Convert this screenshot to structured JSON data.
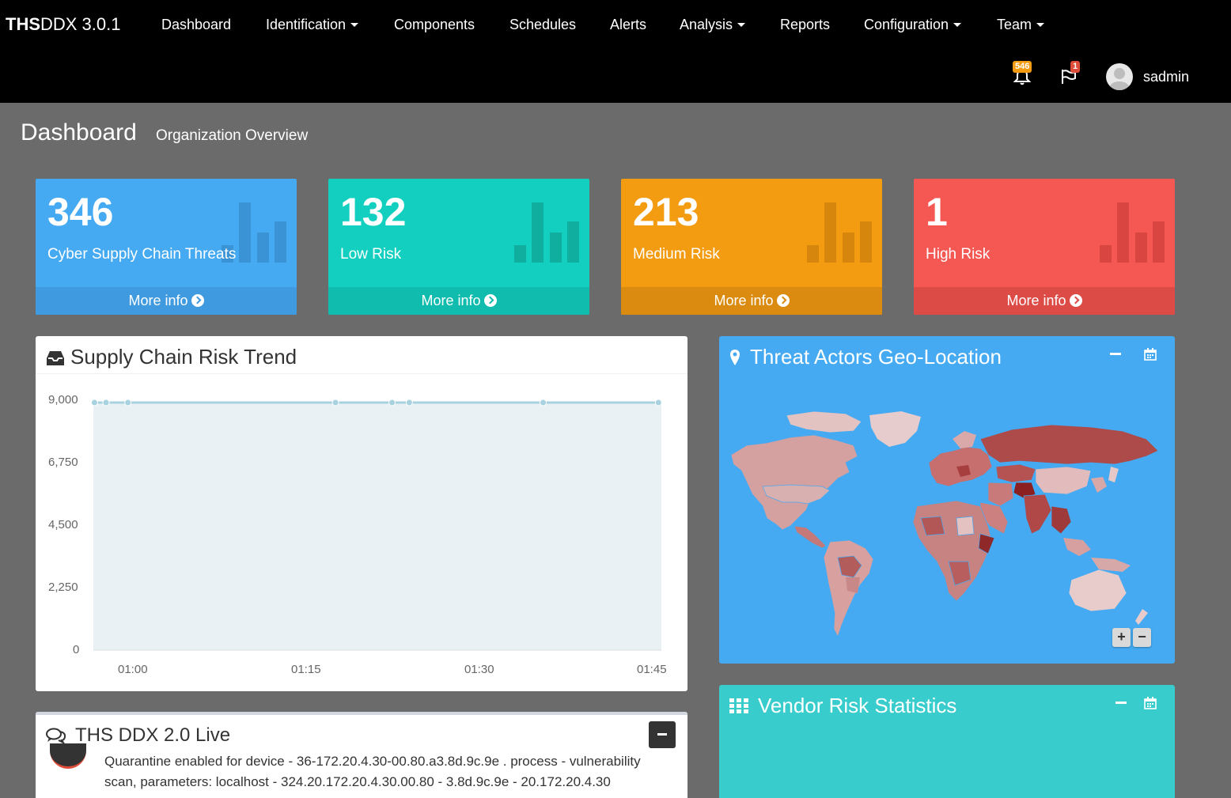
{
  "brand": {
    "bold": "THS",
    "rest": "DDX 3.0.1"
  },
  "nav": {
    "dashboard": "Dashboard",
    "identification": "Identification",
    "components": "Components",
    "schedules": "Schedules",
    "alerts": "Alerts",
    "analysis": "Analysis",
    "reports": "Reports",
    "configuration": "Configuration",
    "team": "Team"
  },
  "topbar": {
    "notifications_count": "546",
    "flags_count": "1",
    "username": "sadmin",
    "notification_badge_color": "#f39c12",
    "flag_badge_color": "#dd4b39"
  },
  "header": {
    "title": "Dashboard",
    "subtitle": "Organization Overview"
  },
  "stats": [
    {
      "value": "346",
      "label": "Cyber Supply Chain Threats",
      "footer": "More info",
      "color": "#45aaf2"
    },
    {
      "value": "132",
      "label": "Low Risk",
      "footer": "More info",
      "color": "#12cfbf"
    },
    {
      "value": "213",
      "label": "Medium Risk",
      "footer": "More info",
      "color": "#f39c12"
    },
    {
      "value": "1",
      "label": "High Risk",
      "footer": "More info",
      "color": "#f55753"
    }
  ],
  "trend_panel": {
    "title": "Supply Chain Risk Trend"
  },
  "chart_data": {
    "type": "area",
    "title": "Supply Chain Risk Trend",
    "xlabel": "",
    "ylabel": "",
    "y_ticks": [
      "9,000",
      "6,750",
      "4,500",
      "2,250",
      "0"
    ],
    "x_ticks": [
      "01:00",
      "01:15",
      "01:30",
      "01:45"
    ],
    "ylim": [
      0,
      9000
    ],
    "x_minutes_past_hour": [
      56.6,
      57.6,
      59.5,
      77.5,
      82.4,
      83.9,
      95.5,
      105.5
    ],
    "series": [
      {
        "values": [
          9000,
          9000,
          9000,
          9000,
          9000,
          9000,
          9000,
          9000
        ]
      }
    ],
    "grid": false,
    "line_color": "#a8d2df",
    "fill_color": "#eaf1f4"
  },
  "geo_panel": {
    "title": "Threat Actors Geo-Location",
    "color": "#45aaf2",
    "zoom_in": "+",
    "zoom_out": "−"
  },
  "vendor_panel": {
    "title": "Vendor Risk Statistics",
    "color": "#39cccc"
  },
  "live_panel": {
    "title": "THS DDX 2.0 Live",
    "message": "Quarantine enabled for device - 36-172.20.4.30-00.80.a3.8d.9c.9e . process - vulnerability scan, parameters:",
    "message_cont": "localhost - 324.20.172.20.4.30.00.80 - 3.8d.9c.9e - 20.172.20.4.30"
  }
}
